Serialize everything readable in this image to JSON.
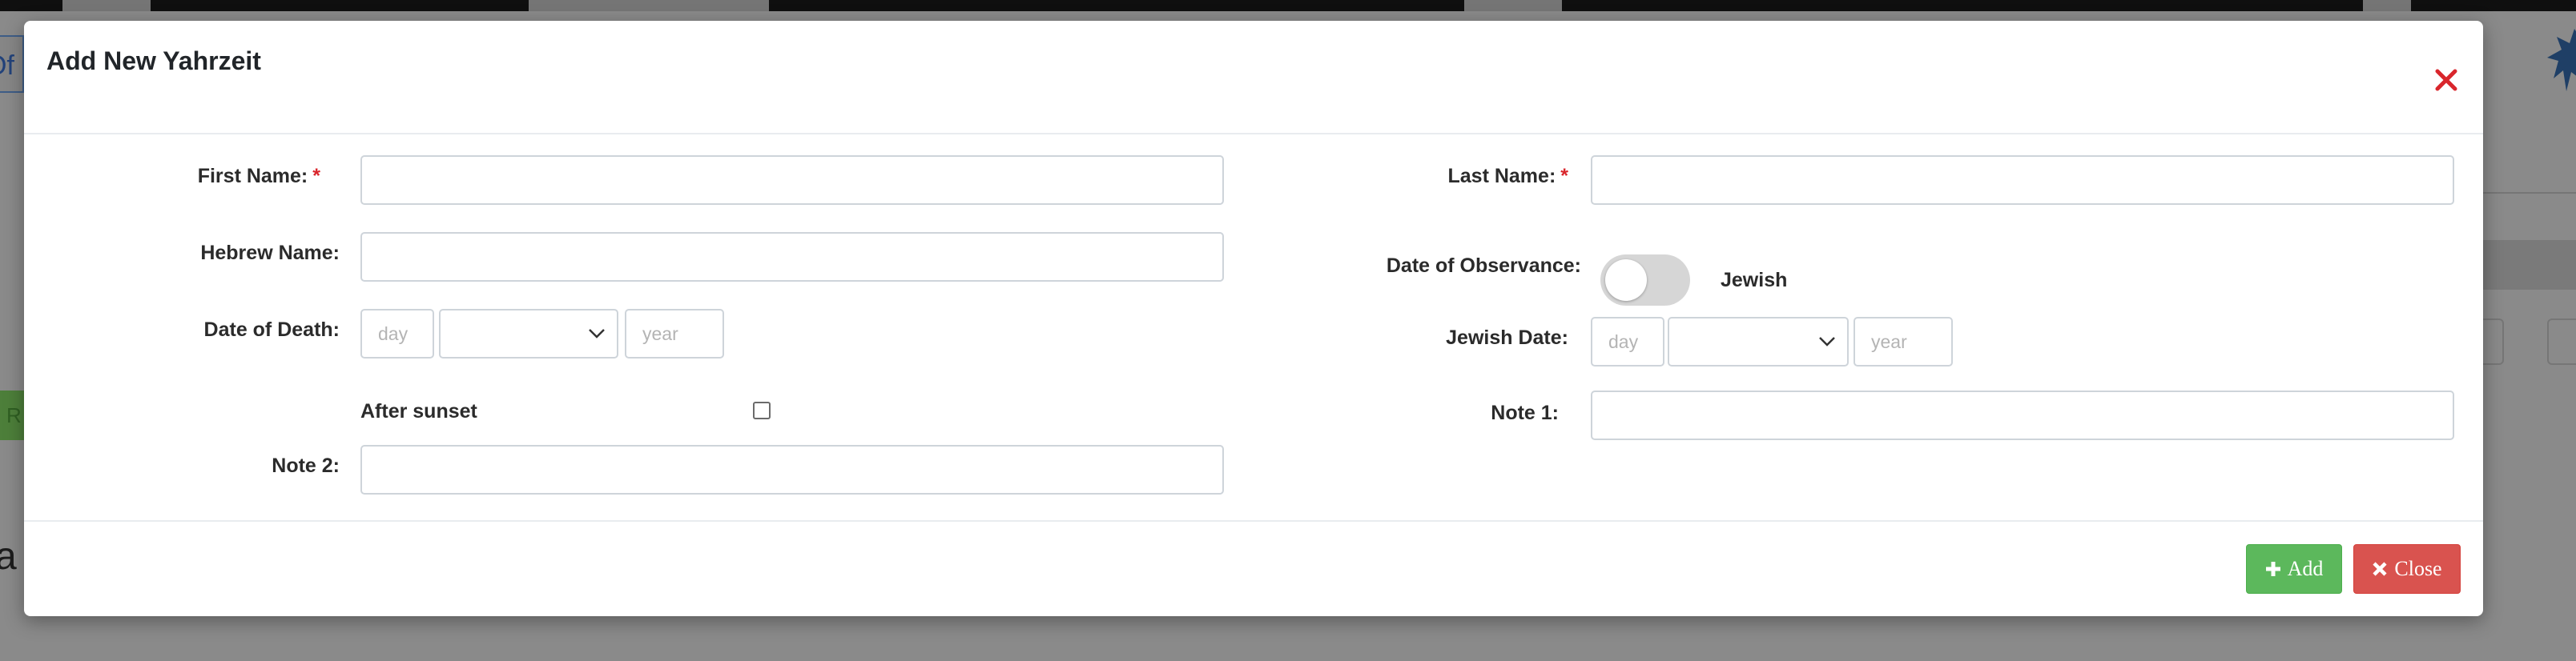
{
  "modal": {
    "title": "Add New Yahrzeit"
  },
  "form": {
    "first_name": {
      "label": "First Name:",
      "required_mark": "*",
      "value": ""
    },
    "last_name": {
      "label": "Last Name:",
      "required_mark": "*",
      "value": ""
    },
    "hebrew_name": {
      "label": "Hebrew Name:",
      "value": ""
    },
    "date_of_observance": {
      "label": "Date of Observance:",
      "toggle_text": "Jewish",
      "toggle_on": false
    },
    "date_of_death": {
      "label": "Date of Death:",
      "day_placeholder": "day",
      "month_value": "",
      "year_placeholder": "year"
    },
    "jewish_date": {
      "label": "Jewish Date:",
      "day_placeholder": "day",
      "month_value": "",
      "year_placeholder": "year"
    },
    "after_sunset": {
      "label": "After sunset",
      "checked": false
    },
    "note1": {
      "label": "Note 1:",
      "value": ""
    },
    "note2": {
      "label": "Note 2:",
      "value": ""
    }
  },
  "footer": {
    "add_label": "Add",
    "close_label": "Close"
  },
  "background": {
    "left_tab_text": "Of",
    "green_button_text": "R",
    "big_text": "ad"
  },
  "colors": {
    "required": "#d9262c",
    "close_x": "#d9262c",
    "add_button": "#5cb85c",
    "close_button": "#d9534f",
    "overlay": "#8a8a8a"
  },
  "icons": {
    "close_x": "close-icon",
    "add": "plus-icon",
    "close": "times-icon",
    "select_arrow": "chevron-down-icon"
  }
}
